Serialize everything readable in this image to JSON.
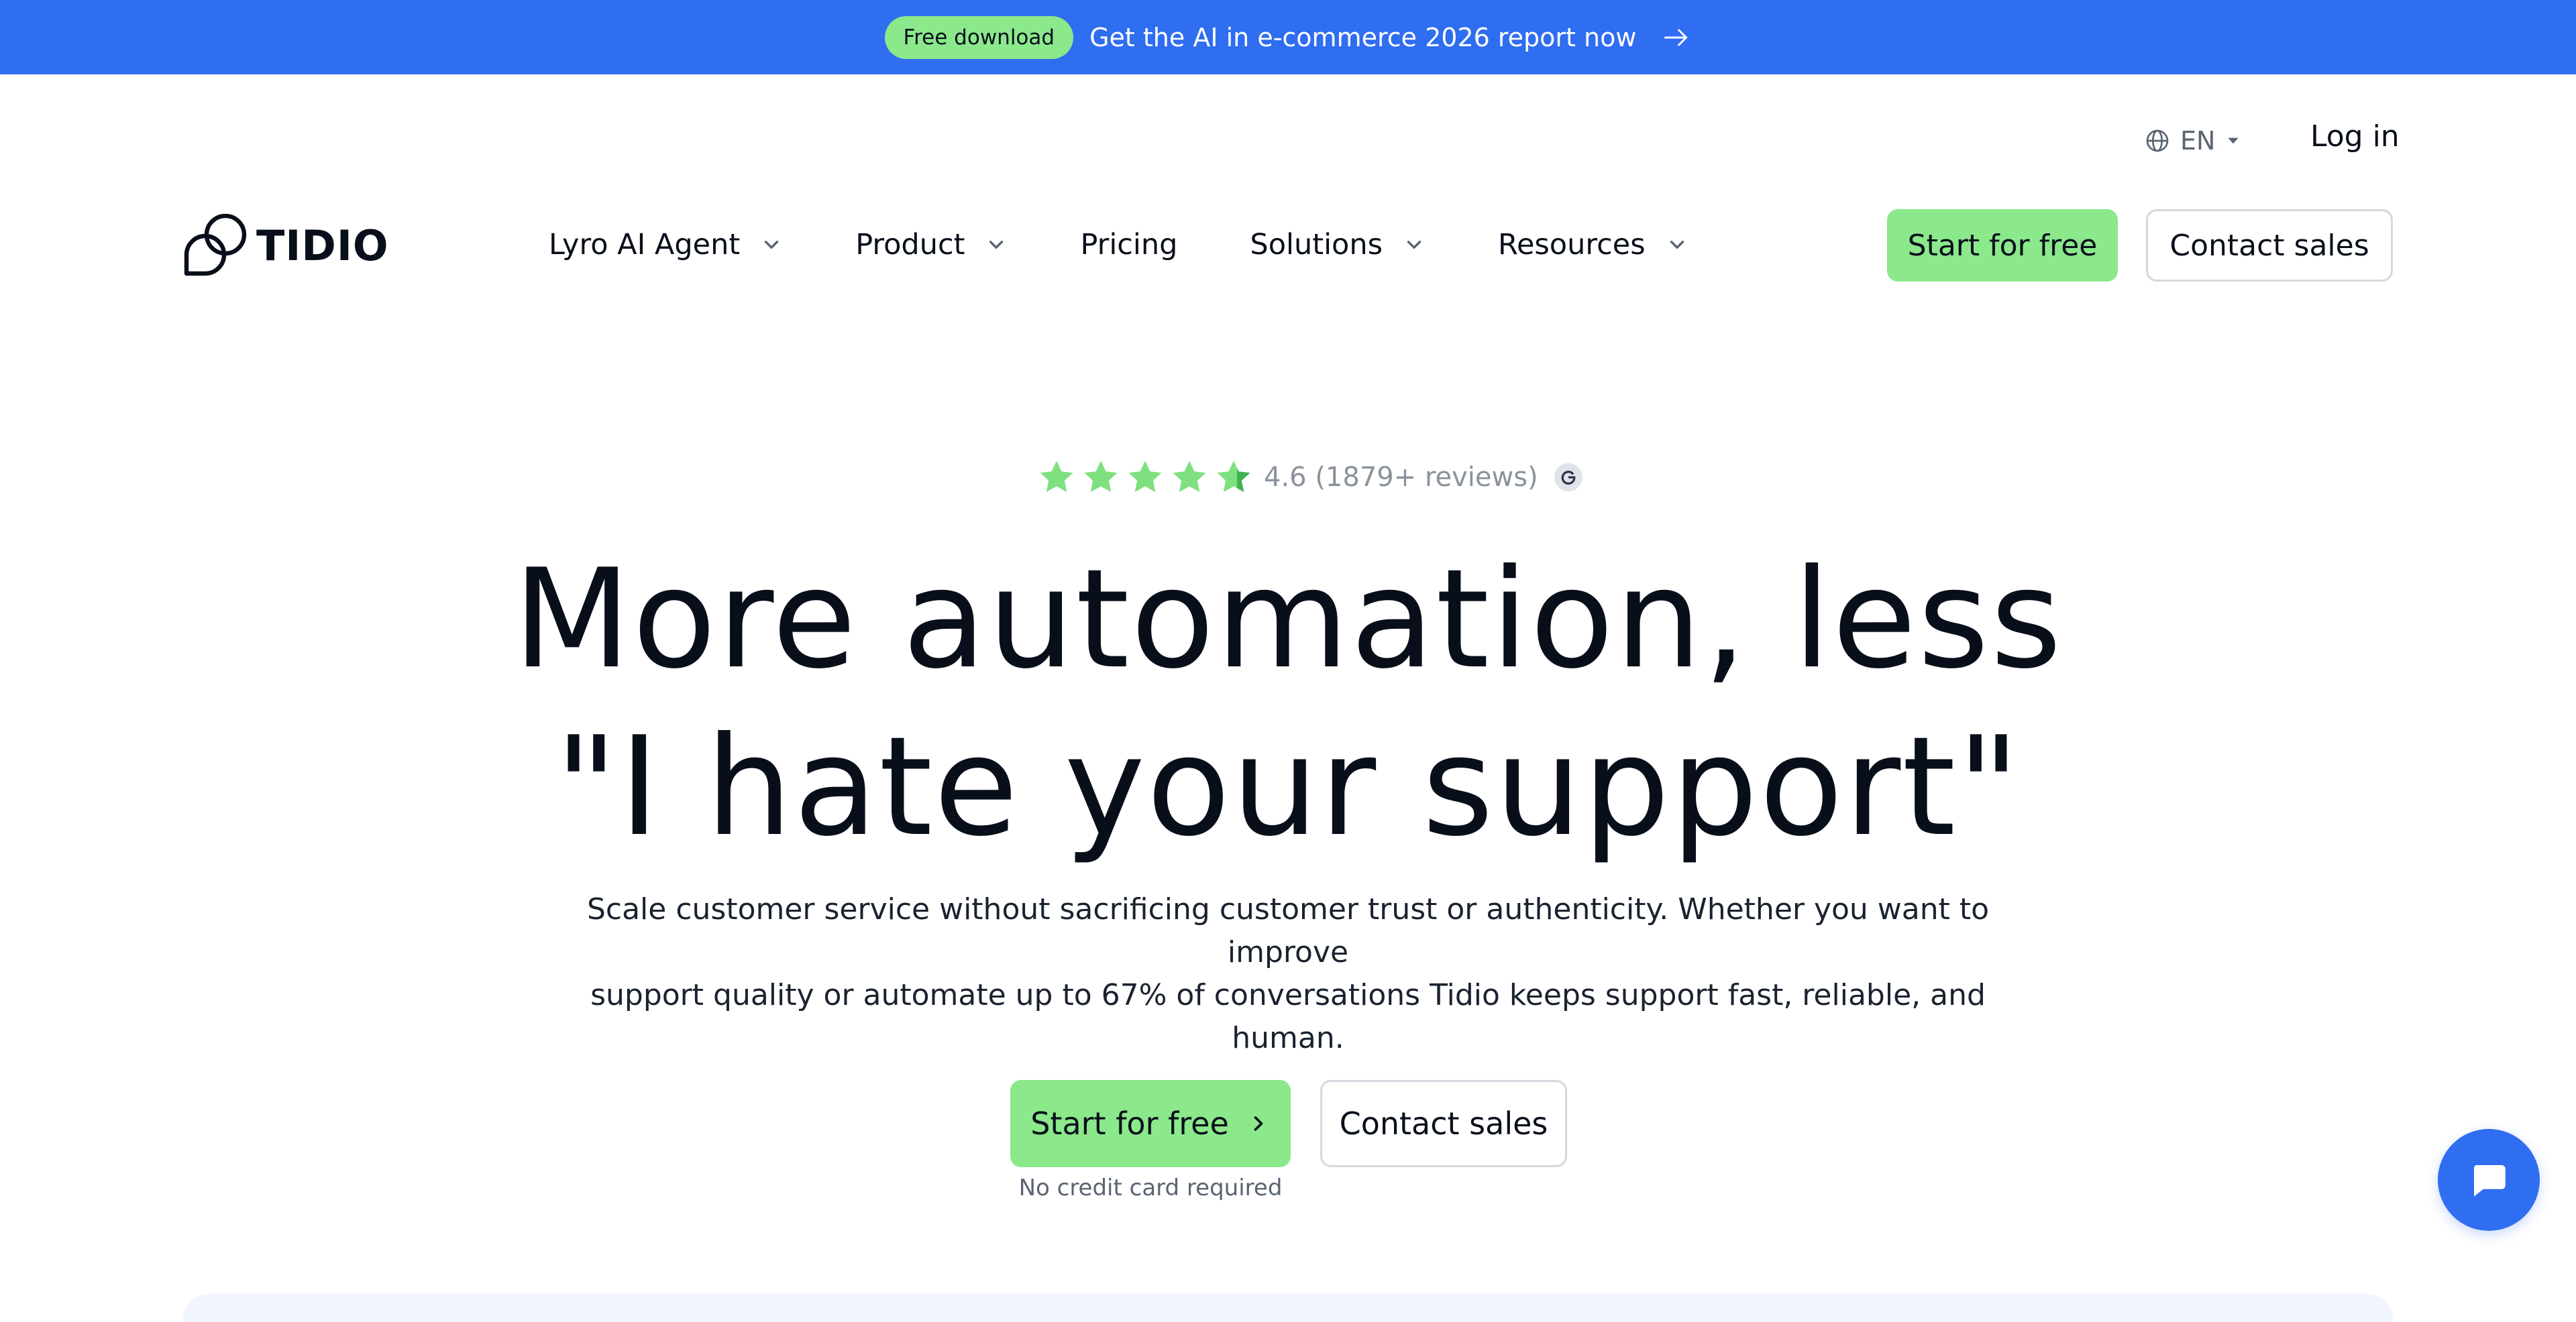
{
  "announcement": {
    "badge": "Free download",
    "message": "Get the AI in e-commerce 2026 report now",
    "icon": "arrow-right-icon"
  },
  "utility": {
    "language": "EN",
    "language_icon": "globe-icon",
    "login": "Log in"
  },
  "brand": {
    "name": "TIDIO",
    "logo_icon": "tidio-logo-icon"
  },
  "nav": {
    "items": [
      {
        "label": "Lyro AI Agent",
        "has_dropdown": true
      },
      {
        "label": "Product",
        "has_dropdown": true
      },
      {
        "label": "Pricing",
        "has_dropdown": false
      },
      {
        "label": "Solutions",
        "has_dropdown": true
      },
      {
        "label": "Resources",
        "has_dropdown": true
      }
    ],
    "start_label": "Start for free",
    "contact_label": "Contact sales"
  },
  "hero": {
    "rating": {
      "stars": 4.6,
      "stars_max": 5,
      "text": "4.6 (1879+ reviews)",
      "source_icon": "g2-icon"
    },
    "headline_line1": "More automation, less",
    "headline_line2": "\"I hate your support\"",
    "subtext_line1": "Scale customer service without sacrificing customer trust or authenticity. Whether you want to improve",
    "subtext_line2": "support quality or automate up to 67% of conversations Tidio keeps support fast, reliable, and human.",
    "cta_start": "Start for free",
    "cta_contact": "Contact sales",
    "note": "No credit card required"
  },
  "colors": {
    "brand_blue": "#2f6df1",
    "accent_green": "#8be88b",
    "star_green": "#7fe07f",
    "text_dark": "#080f1a"
  },
  "chat_widget": {
    "icon": "chat-bubble-icon"
  }
}
